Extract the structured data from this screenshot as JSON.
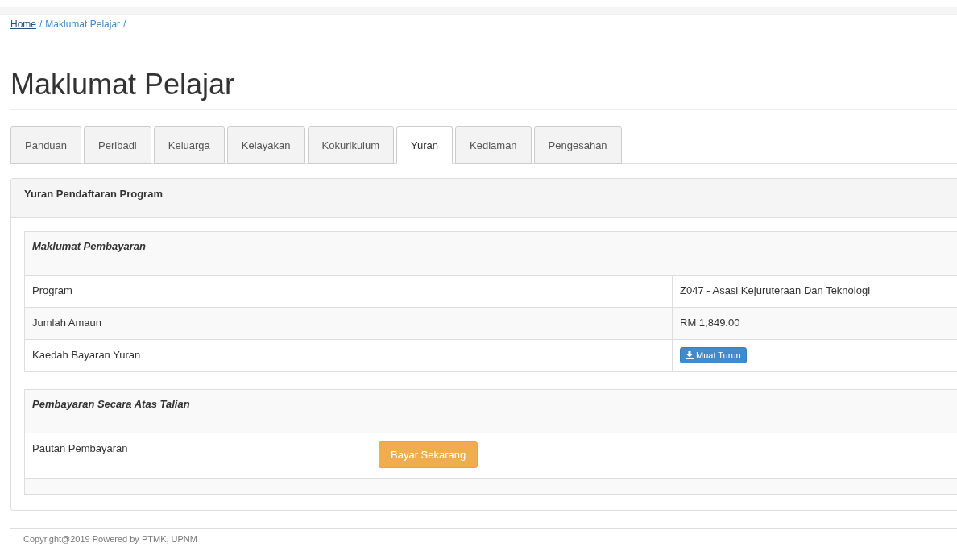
{
  "breadcrumb": [
    {
      "label": "Home",
      "current": false,
      "separator": "/"
    },
    {
      "label": "Maklumat Pelajar",
      "current": true,
      "separator": "/"
    }
  ],
  "page_title": "Maklumat Pelajar",
  "tabs": [
    {
      "label": "Panduan",
      "selected": false
    },
    {
      "label": "Peribadi",
      "selected": false
    },
    {
      "label": "Keluarga",
      "selected": false
    },
    {
      "label": "Kelayakan",
      "selected": false
    },
    {
      "label": "Kokurikulum",
      "selected": false
    },
    {
      "label": "Yuran",
      "selected": true
    },
    {
      "label": "Kediaman",
      "selected": false
    },
    {
      "label": "Pengesahan",
      "selected": false
    }
  ],
  "panel": {
    "title": "Yuran Pendaftaran Program",
    "payment_info": {
      "heading": "Maklumat Pembayaran",
      "rows": [
        {
          "label": "Program",
          "kind": "text",
          "value": "Z047 - Asasi Kejuruteraan Dan Teknologi"
        },
        {
          "label": "Jumlah Amaun",
          "kind": "text",
          "value": "RM 1,849.00"
        },
        {
          "label": "Kaedah Bayaran Yuran",
          "kind": "download",
          "value": "Muat Turun"
        }
      ]
    },
    "online_payment": {
      "heading": "Pembayaran Secara Atas Talian",
      "rows": [
        {
          "label": "Pautan Pembayaran",
          "kind": "pay",
          "value": "Bayar Sekarang"
        }
      ]
    }
  },
  "footer": "Copyright@2019 Powered by PTMK, UPNM"
}
